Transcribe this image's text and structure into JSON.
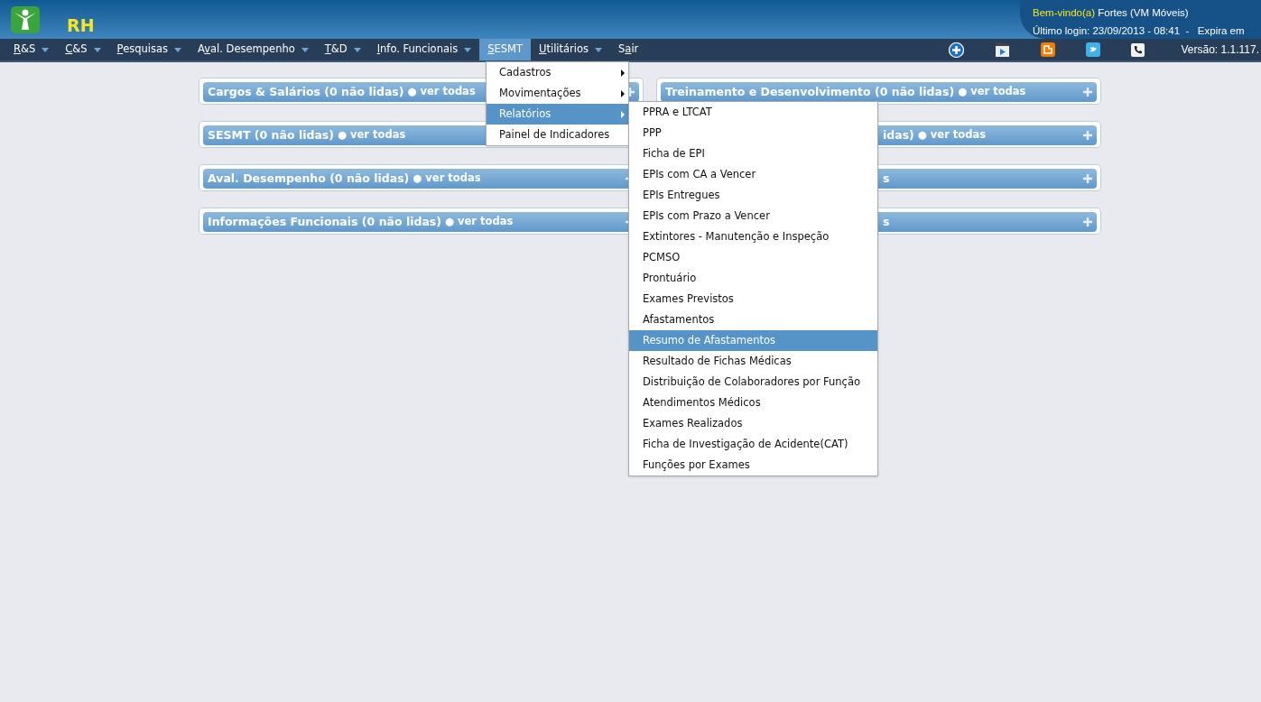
{
  "app": {
    "title": "RH"
  },
  "user": {
    "greeting": "Bem-vindo(a)",
    "name": "Fortes (VM Móveis)",
    "last_login": "Último login: 23/09/2013 - 08:41  -   Expira em"
  },
  "menu": [
    {
      "access_key": "R",
      "rest": "&S",
      "selected": false,
      "has_caret": true
    },
    {
      "access_key": "C",
      "rest": "&S",
      "selected": false,
      "has_caret": true
    },
    {
      "access_key": "P",
      "rest": "esquisas",
      "selected": false,
      "has_caret": true
    },
    {
      "lead": "A",
      "access_key": "v",
      "rest": "al. Desempenho",
      "selected": false,
      "has_caret": true
    },
    {
      "access_key": "T",
      "rest": "&D",
      "selected": false,
      "has_caret": true
    },
    {
      "access_key": "I",
      "rest": "nfo. Funcionais",
      "selected": false,
      "has_caret": true
    },
    {
      "access_key": "S",
      "rest": "ESMT",
      "selected": true,
      "has_caret": false
    },
    {
      "access_key": "U",
      "rest": "tilitários",
      "selected": false,
      "has_caret": true
    },
    {
      "lead": "S",
      "access_key": "a",
      "rest": "ir",
      "selected": false,
      "has_caret": false
    }
  ],
  "toolbar": [
    {
      "kind": "plus"
    },
    {
      "kind": "video"
    },
    {
      "kind": "blog"
    },
    {
      "kind": "twitter"
    },
    {
      "kind": "phone"
    }
  ],
  "version": "Versão: 1.1.117.",
  "panels_left": [
    {
      "title": "Cargos & Salários (0 não lidas)",
      "link": "● ver todas",
      "expand_icon": true
    },
    {
      "title": "SESMT (0 não lidas)",
      "link": "● ver todas"
    },
    {
      "title": "Aval. Desempenho (0 não lidas)",
      "link": "● ver todas",
      "expand_icon": true
    },
    {
      "title": "Informações Funcionais (0 não lidas)",
      "link": "● ver todas",
      "expand_icon": true
    }
  ],
  "panels_right": [
    {
      "kind": "full",
      "title": "Treinamento e Desenvolvimento (0 não lidas)",
      "link": "● ver todas"
    },
    {
      "kind": "cut",
      "title": "idas)",
      "link": "● ver todas"
    },
    {
      "kind": "cut",
      "title": "s"
    },
    {
      "kind": "cut",
      "title": "s"
    }
  ],
  "dropdown": [
    {
      "label": "Cadastros",
      "has_submenu": true,
      "selected": false
    },
    {
      "label": "Movimentações",
      "has_submenu": true,
      "selected": false
    },
    {
      "label": "Relatórios",
      "has_submenu": true,
      "selected": true
    },
    {
      "label": "Painel de Indicadores",
      "has_submenu": false,
      "selected": false
    }
  ],
  "submenu": [
    {
      "label": "PPRA e LTCAT",
      "selected": false
    },
    {
      "label": "PPP",
      "selected": false
    },
    {
      "label": "Ficha de EPI",
      "selected": false
    },
    {
      "label": "EPIs com CA a Vencer",
      "selected": false
    },
    {
      "label": "EPIs Entregues",
      "selected": false
    },
    {
      "label": "EPIs com Prazo a Vencer",
      "selected": false
    },
    {
      "label": "Extintores - Manutenção e Inspeção",
      "selected": false
    },
    {
      "label": "PCMSO",
      "selected": false
    },
    {
      "label": "Prontuário",
      "selected": false
    },
    {
      "label": "Exames Previstos",
      "selected": false
    },
    {
      "label": "Afastamentos",
      "selected": false
    },
    {
      "label": "Resumo de Afastamentos",
      "selected": true
    },
    {
      "label": "Resultado de Fichas Médicas",
      "selected": false
    },
    {
      "label": "Distribuição de Colaboradores por Função",
      "selected": false
    },
    {
      "label": "Atendimentos Médicos",
      "selected": false
    },
    {
      "label": "Exames Realizados",
      "selected": false
    },
    {
      "label": "Ficha de Investigação de Acidente(CAT)",
      "selected": false
    },
    {
      "label": "Funções por Exames",
      "selected": false
    }
  ]
}
